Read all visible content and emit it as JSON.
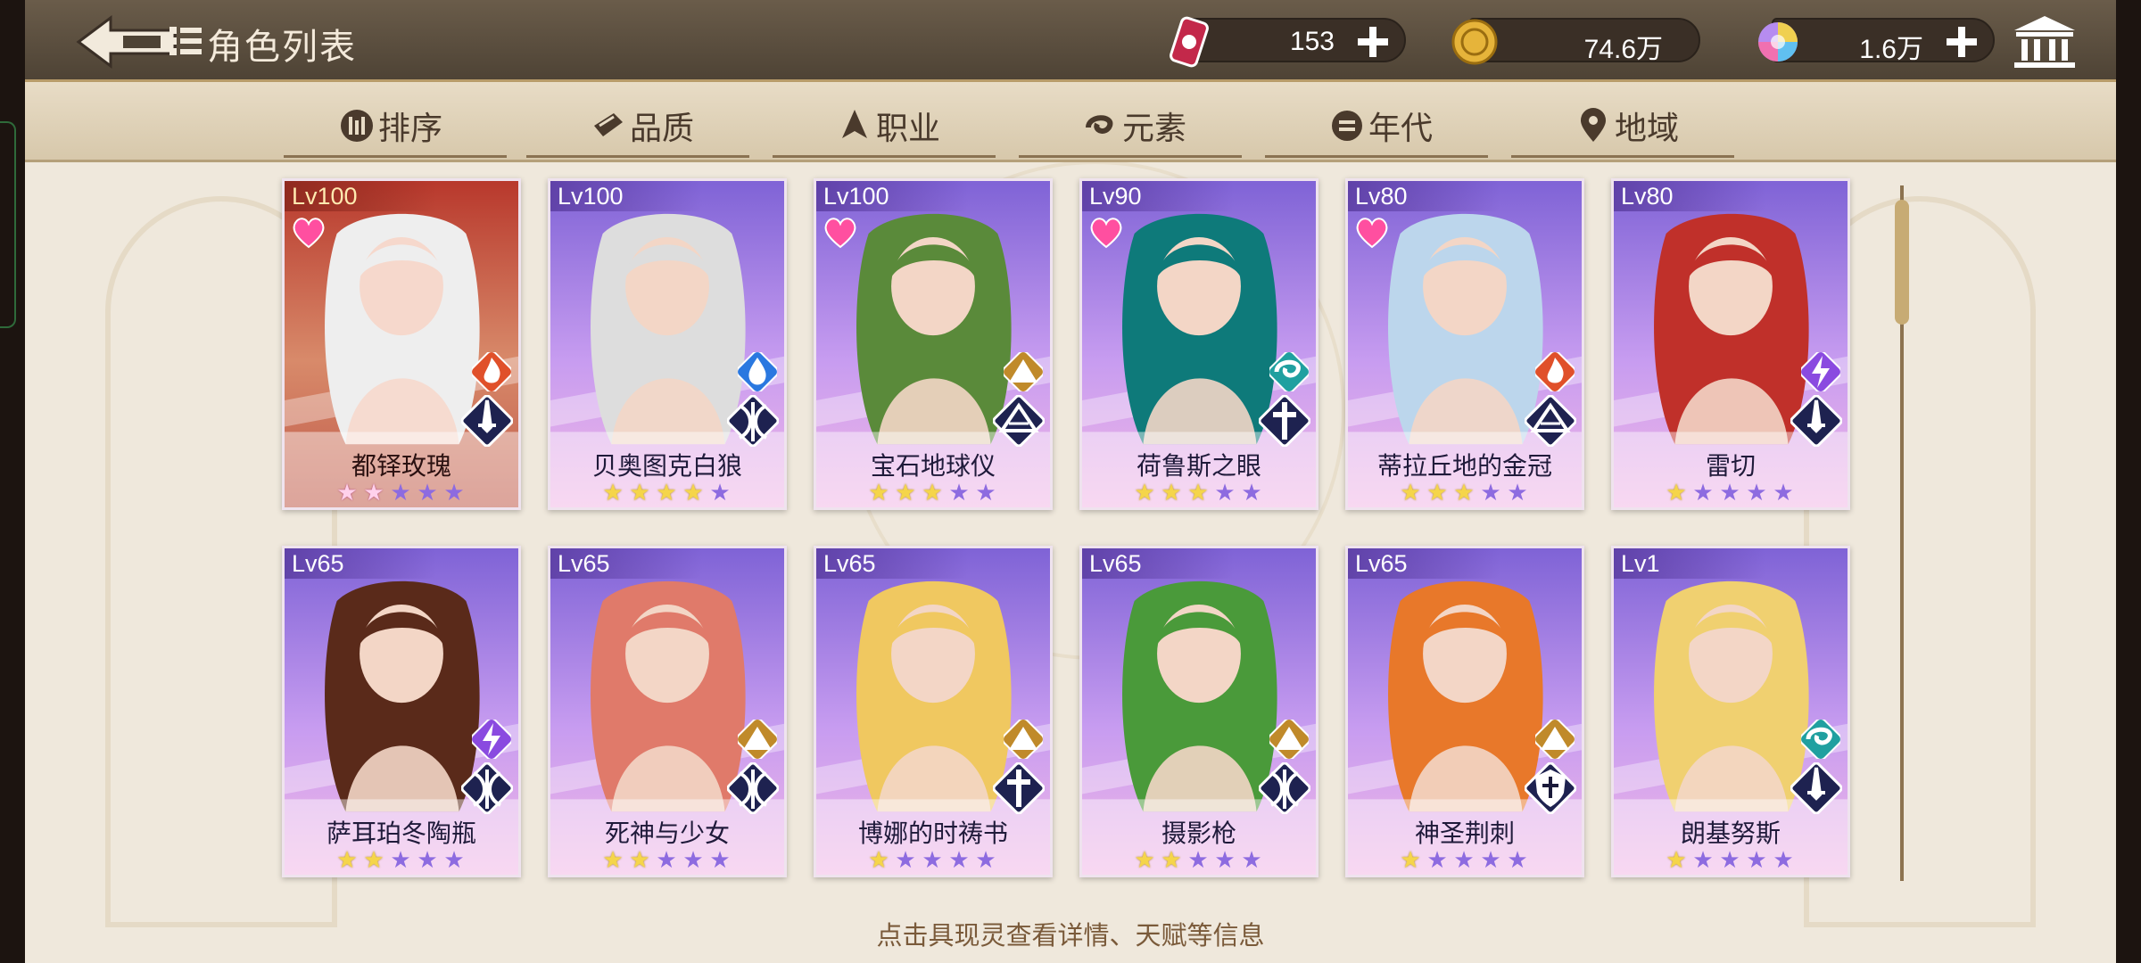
{
  "header": {
    "title": "角色列表",
    "currencies": [
      {
        "name": "ticket",
        "value": "153"
      },
      {
        "name": "gold",
        "value": "74.6万"
      },
      {
        "name": "gem",
        "value": "1.6万"
      }
    ]
  },
  "tabs": [
    {
      "label": "排序",
      "icon": "sort-icon"
    },
    {
      "label": "品质",
      "icon": "quality-icon"
    },
    {
      "label": "职业",
      "icon": "class-icon"
    },
    {
      "label": "元素",
      "icon": "element-icon"
    },
    {
      "label": "年代",
      "icon": "era-icon"
    },
    {
      "label": "地域",
      "icon": "region-icon"
    }
  ],
  "cards": [
    {
      "level": "Lv100",
      "name": "都铎玫瑰",
      "heart": true,
      "element": "fire",
      "class": "sword",
      "stars_on": 2,
      "theme": "red"
    },
    {
      "level": "Lv100",
      "name": "贝奥图克白狼",
      "heart": false,
      "element": "water",
      "class": "bow",
      "stars_on": 4,
      "theme": "purple"
    },
    {
      "level": "Lv100",
      "name": "宝石地球仪",
      "heart": true,
      "element": "earth",
      "class": "book",
      "stars_on": 3,
      "theme": "purple"
    },
    {
      "level": "Lv90",
      "name": "荷鲁斯之眼",
      "heart": true,
      "element": "wind",
      "class": "cross",
      "stars_on": 3,
      "theme": "purple"
    },
    {
      "level": "Lv80",
      "name": "蒂拉丘地的金冠",
      "heart": true,
      "element": "fire",
      "class": "book",
      "stars_on": 3,
      "theme": "purple"
    },
    {
      "level": "Lv80",
      "name": "雷切",
      "heart": false,
      "element": "thunder",
      "class": "sword",
      "stars_on": 1,
      "theme": "purple"
    },
    {
      "level": "Lv65",
      "name": "萨耳珀冬陶瓶",
      "heart": false,
      "element": "thunder",
      "class": "bow",
      "stars_on": 2,
      "theme": "purple"
    },
    {
      "level": "Lv65",
      "name": "死神与少女",
      "heart": false,
      "element": "earth",
      "class": "bow",
      "stars_on": 2,
      "theme": "purple"
    },
    {
      "level": "Lv65",
      "name": "博娜的时祷书",
      "heart": false,
      "element": "earth",
      "class": "cross",
      "stars_on": 1,
      "theme": "purple"
    },
    {
      "level": "Lv65",
      "name": "摄影枪",
      "heart": false,
      "element": "earth",
      "class": "bow",
      "stars_on": 2,
      "theme": "purple"
    },
    {
      "level": "Lv65",
      "name": "神圣荆刺",
      "heart": false,
      "element": "earth",
      "class": "shield",
      "stars_on": 1,
      "theme": "purple"
    },
    {
      "level": "Lv1",
      "name": "朗基努斯",
      "heart": false,
      "element": "wind",
      "class": "sword",
      "stars_on": 1,
      "theme": "purple"
    }
  ],
  "hint": "点击具现灵查看详情、天赋等信息",
  "colors": {
    "accent_gold": "#c7ab74",
    "card_purple": "#b58df0",
    "card_red": "#b8382c"
  }
}
